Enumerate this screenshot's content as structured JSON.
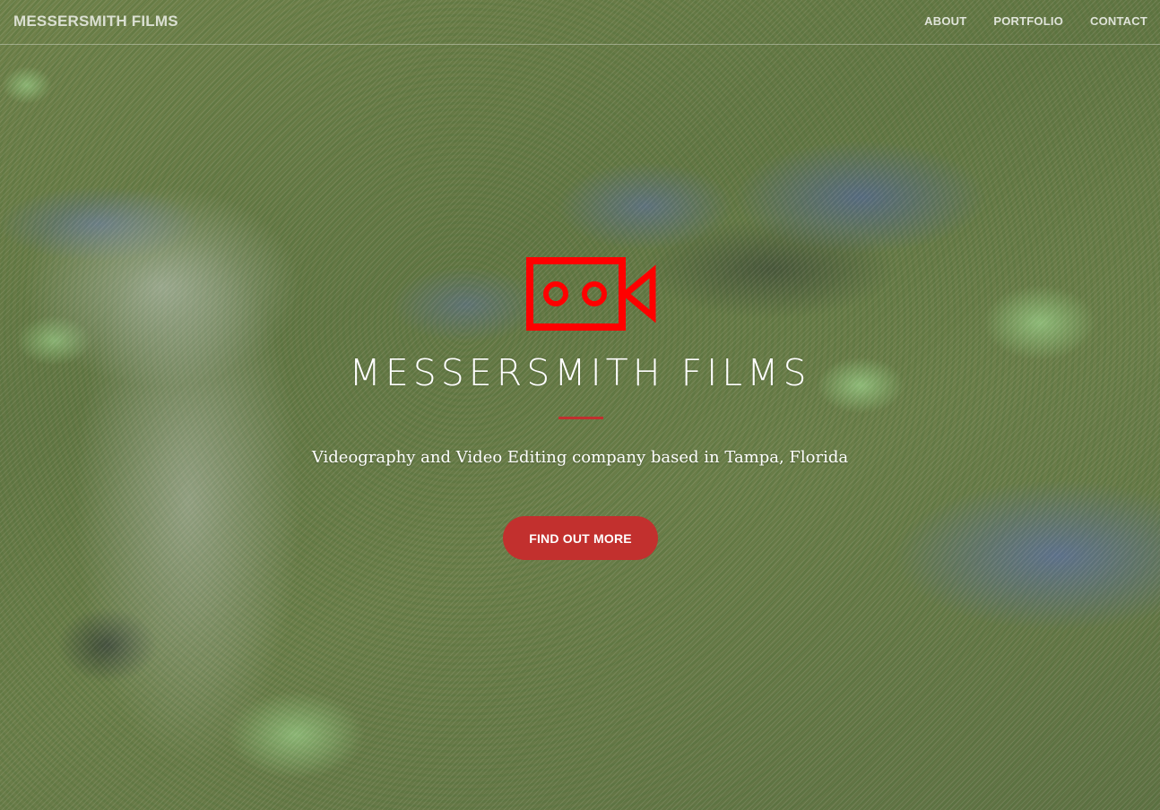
{
  "navbar": {
    "brand": "MESSERSMITH FILMS",
    "links": [
      {
        "label": "ABOUT"
      },
      {
        "label": "PORTFOLIO"
      },
      {
        "label": "CONTACT"
      }
    ]
  },
  "hero": {
    "logo_icon": "video-camera-icon",
    "title": "MESSERSMITH FILMS",
    "tagline": "Videography and Video Editing company based in Tampa, Florida",
    "cta_label": "FIND OUT MORE"
  },
  "colors": {
    "accent": "#c2302e",
    "logo": "#ff0000",
    "text": "#ffffff"
  }
}
